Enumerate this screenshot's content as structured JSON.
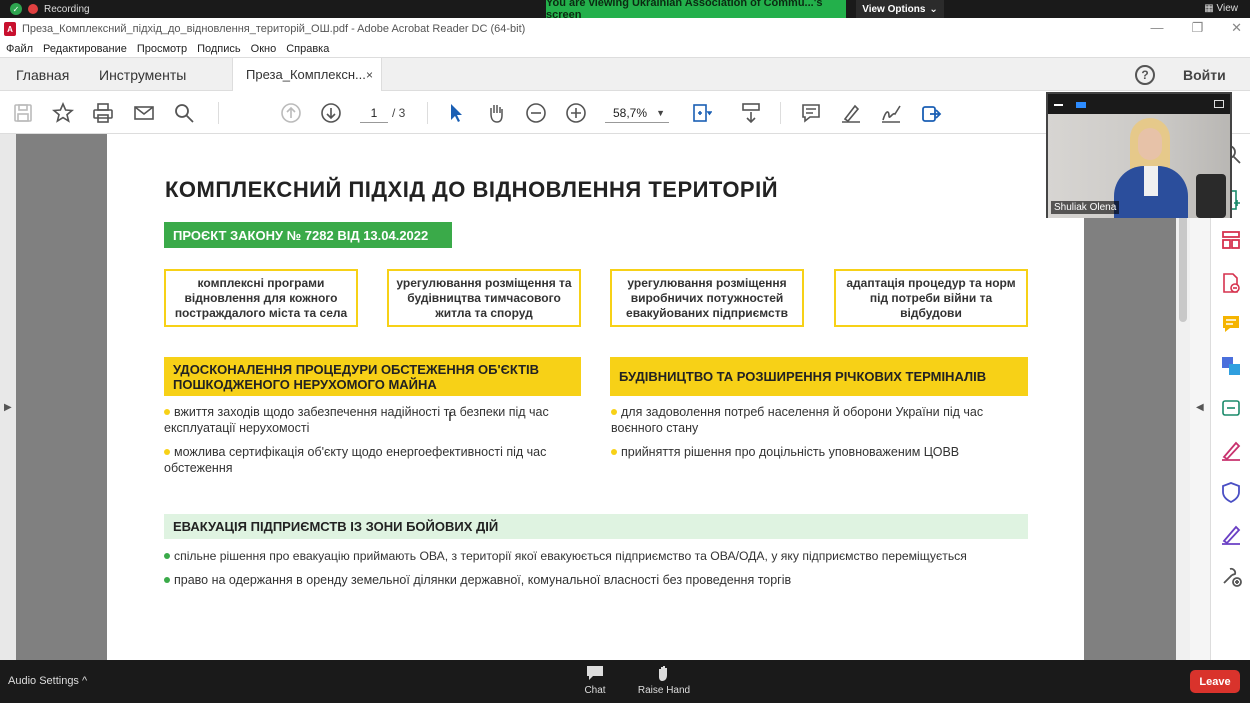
{
  "zoom": {
    "recording": "Recording",
    "viewing_banner": "You are viewing Ukrainian Association of Commu...'s screen",
    "view_options": "View Options",
    "view_right": "View",
    "participant_name": "Shuliak Olena",
    "audio_settings": "Audio Settings",
    "chat": "Chat",
    "raise_hand": "Raise Hand",
    "leave": "Leave",
    "colors": {
      "banner": "#23b04b",
      "leave": "#d9332c"
    }
  },
  "acrobat": {
    "window_title": "Преза_Комплексний_підхід_до_відновлення_територій_ОШ.pdf - Adobe Acrobat Reader DC (64-bit)",
    "menu": [
      "Файл",
      "Редактирование",
      "Просмотр",
      "Подпись",
      "Окно",
      "Справка"
    ],
    "tabs": {
      "home": "Главная",
      "tools": "Инструменты",
      "doc": "Преза_Комплексн...",
      "close": "×"
    },
    "help": "?",
    "login": "Войти",
    "page_current": "1",
    "page_total": "/ 3",
    "zoom_level": "58,7%",
    "icons": [
      "save-icon",
      "star-icon",
      "print-icon",
      "mail-icon",
      "search-icon",
      "page-up-icon",
      "page-down-icon",
      "select-icon",
      "hand-icon",
      "zoom-out-icon",
      "zoom-in-icon",
      "fit-icon",
      "scroll-mode-icon",
      "comment-icon",
      "highlight-icon",
      "sign-icon",
      "share-icon"
    ]
  },
  "slide": {
    "title": "КОМПЛЕКСНИЙ ПІДХІД ДО ВІДНОВЛЕННЯ ТЕРИТОРІЙ",
    "law": "ПРОЄКТ ЗАКОНУ № 7282 ВІД 13.04.2022",
    "boxes": [
      "комплексні програми відновлення для кожного постраждалого міста та села",
      "урегулювання розміщення та будівництва тимчасового житла та споруд",
      "урегулювання розміщення виробничих потужностей евакуйованих підприємств",
      "адаптація процедур та норм під потреби війни та відбудови"
    ],
    "section1": {
      "title": "УДОСКОНАЛЕННЯ ПРОЦЕДУРИ ОБСТЕЖЕННЯ ОБ'ЄКТІВ ПОШКОДЖЕНОГО НЕРУХОМОГО МАЙНА",
      "bullets": [
        "вжиття заходів щодо забезпечення надійності та безпеки під час експлуатації нерухомості",
        "можлива сертифікація об'єкту щодо енергоефективності під час обстеження"
      ]
    },
    "section2": {
      "title": "БУДІВНИЦТВО ТА РОЗШИРЕННЯ РІЧКОВИХ ТЕРМІНАЛІВ",
      "bullets": [
        "для задоволення потреб населення й оборони України під час воєнного стану",
        "прийняття рішення про доцільність уповноваженим ЦОВВ"
      ]
    },
    "section3": {
      "title": "ЕВАКУАЦІЯ ПІДПРИЄМСТВ ІЗ ЗОНИ БОЙОВИХ ДІЙ",
      "bullets": [
        "спільне рішення про евакуацію приймають ОВА, з території якої евакуюється підприємство та ОВА/ОДА, у яку підприємство переміщується",
        "право на одержання в оренду земельної ділянки державної, комунальної власності без проведення торгів"
      ]
    },
    "colors": {
      "yellow": "#f7d117",
      "green": "#3aaa49",
      "light_green": "#dff3e1"
    }
  }
}
